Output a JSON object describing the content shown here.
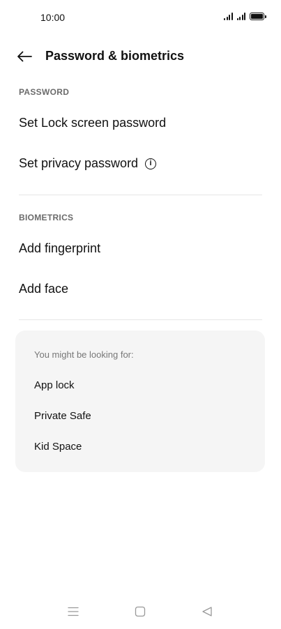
{
  "status_bar": {
    "time": "10:00"
  },
  "header": {
    "title": "Password & biometrics"
  },
  "password_section": {
    "header": "PASSWORD",
    "items": [
      "Set Lock screen password",
      "Set privacy password"
    ]
  },
  "biometrics_section": {
    "header": "BIOMETRICS",
    "items": [
      "Add fingerprint",
      "Add face"
    ]
  },
  "suggestions": {
    "title": "You might be looking for:",
    "items": [
      "App lock",
      "Private Safe",
      "Kid Space"
    ]
  },
  "icons": {
    "back": "arrow-left-icon",
    "info": "info-icon",
    "nav_menu": "menu-icon",
    "nav_home": "home-square-icon",
    "nav_back": "back-triangle-icon"
  }
}
